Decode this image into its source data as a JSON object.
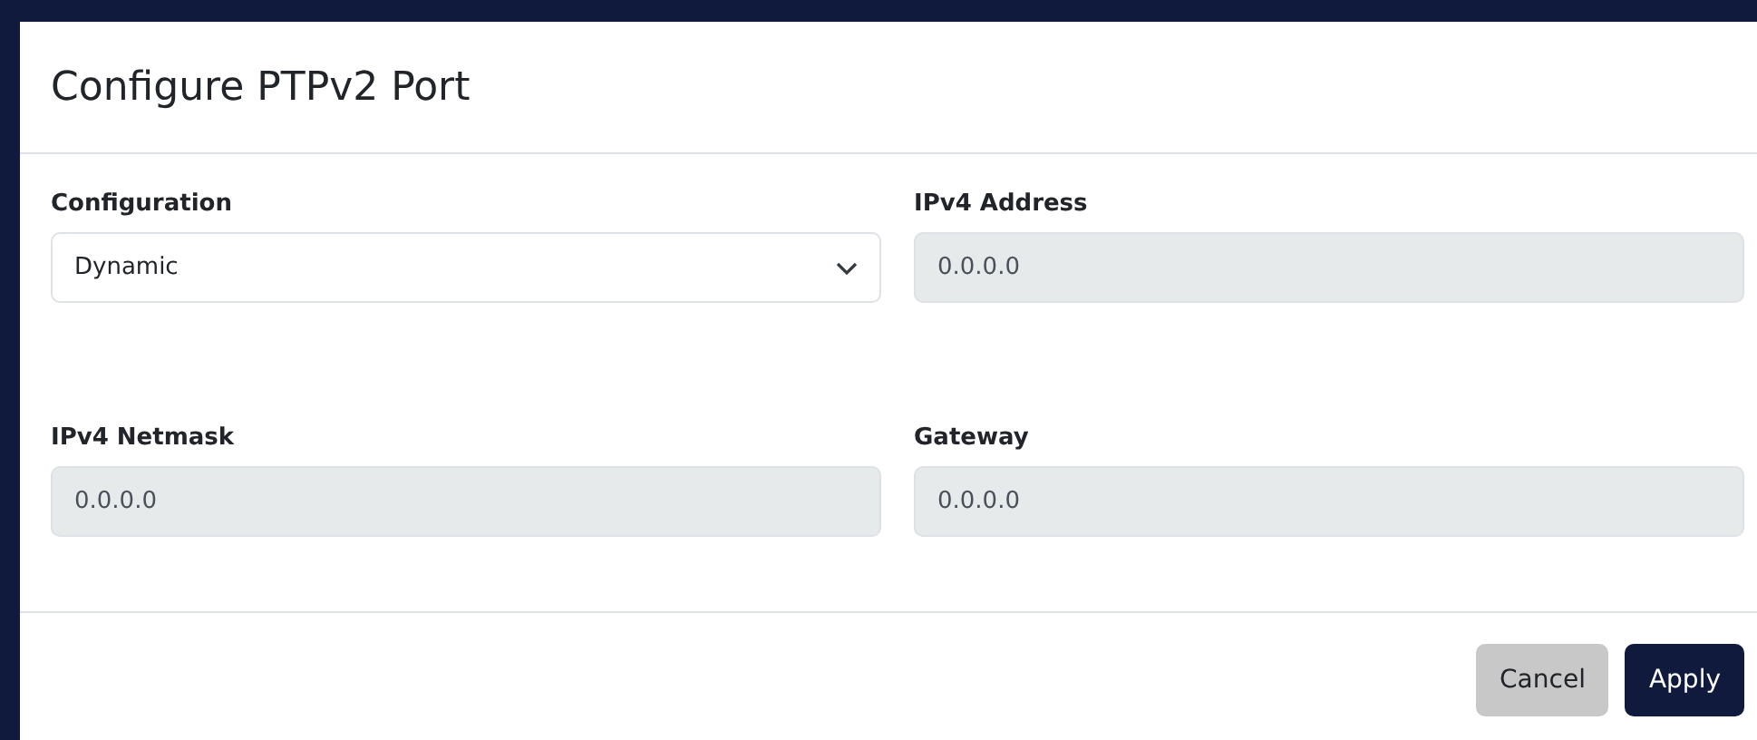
{
  "dialog": {
    "title": "Configure PTPv2 Port"
  },
  "fields": [
    {
      "label": "Configuration",
      "kind": "select",
      "value": "Dynamic",
      "disabled": false
    },
    {
      "label": "IPv4 Address",
      "kind": "text",
      "value": "0.0.0.0",
      "disabled": true
    },
    {
      "label": "IPv4 Netmask",
      "kind": "text",
      "value": "0.0.0.0",
      "disabled": true
    },
    {
      "label": "Gateway",
      "kind": "text",
      "value": "0.0.0.0",
      "disabled": true
    }
  ],
  "buttons": [
    {
      "label": "Cancel",
      "kind": "secondary"
    },
    {
      "label": "Apply",
      "kind": "primary"
    }
  ]
}
